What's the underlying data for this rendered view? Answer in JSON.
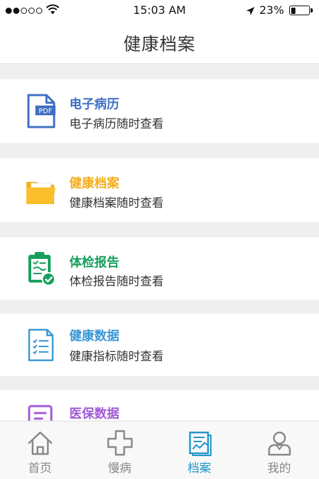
{
  "status_bar": {
    "time": "15:03 AM",
    "battery_percent": "23%",
    "battery_level": 0.23,
    "signal_bars": 2
  },
  "nav": {
    "title": "健康档案"
  },
  "colors": {
    "emr": "#3f6fc4",
    "archive": "#f5ae1b",
    "checkup": "#17a05d",
    "data": "#3a98d6",
    "insurance": "#a05ad6",
    "tab_active": "#2196c8",
    "tab_inactive": "#888888"
  },
  "cards": [
    {
      "title": "电子病历",
      "subtitle": "电子病历随时查看",
      "icon": "pdf-document-icon"
    },
    {
      "title": "健康档案",
      "subtitle": "健康档案随时查看",
      "icon": "folder-icon"
    },
    {
      "title": "体检报告",
      "subtitle": "体检报告随时查看",
      "icon": "clipboard-check-icon"
    },
    {
      "title": "健康数据",
      "subtitle": "健康指标随时查看",
      "icon": "checklist-document-icon"
    },
    {
      "title": "医保数据",
      "icon": "insurance-document-icon"
    }
  ],
  "tabs": [
    {
      "label": "首页",
      "icon": "home-icon"
    },
    {
      "label": "慢病",
      "icon": "medical-cross-icon"
    },
    {
      "label": "档案",
      "icon": "records-icon",
      "active": true
    },
    {
      "label": "我的",
      "icon": "user-icon"
    }
  ]
}
